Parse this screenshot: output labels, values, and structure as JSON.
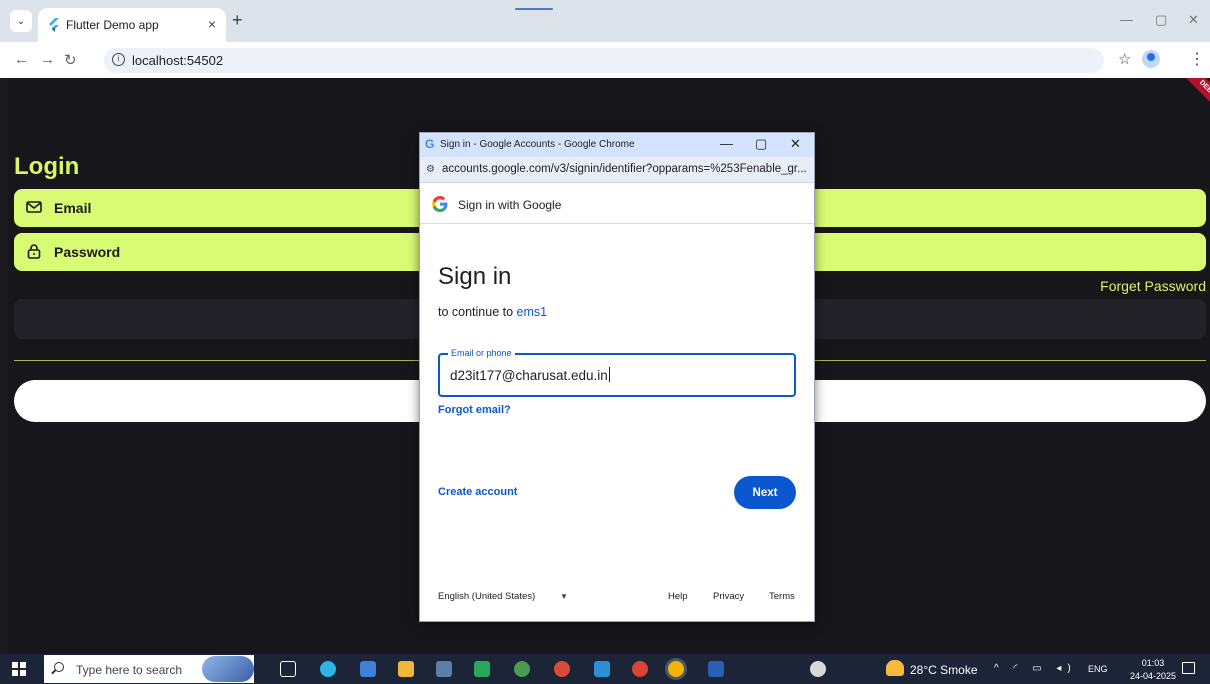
{
  "browser": {
    "tab_title": "Flutter Demo app",
    "tab_close": "×",
    "new_tab": "+",
    "url": "localhost:54502"
  },
  "app": {
    "debug_banner": "DEBUG",
    "title": "Login",
    "email_label": "Email",
    "password_label": "Password",
    "forget_password": "Forget Password",
    "colors": {
      "accent": "#d9fb74",
      "background": "#17161b"
    }
  },
  "popup": {
    "window_title": "Sign in - Google Accounts - Google Chrome",
    "url": "accounts.google.com/v3/signin/identifier?opparams=%253Fenable_gr...",
    "header": "Sign in with Google",
    "heading": "Sign in",
    "continue_prefix": "to continue to ",
    "continue_app": "ems1",
    "email_label": "Email or phone",
    "email_value": "d23it177@charusat.edu.in",
    "forgot_email": "Forgot email?",
    "create_account": "Create account",
    "next": "Next",
    "language": "English (United States)",
    "footer": {
      "help": "Help",
      "privacy": "Privacy",
      "terms": "Terms"
    },
    "colors": {
      "primary": "#0b57d0"
    }
  },
  "taskbar": {
    "search_placeholder": "Type here to search",
    "weather": "28°C  Smoke",
    "lang": "ENG",
    "time": "01:03",
    "date": "24-04-2025"
  }
}
